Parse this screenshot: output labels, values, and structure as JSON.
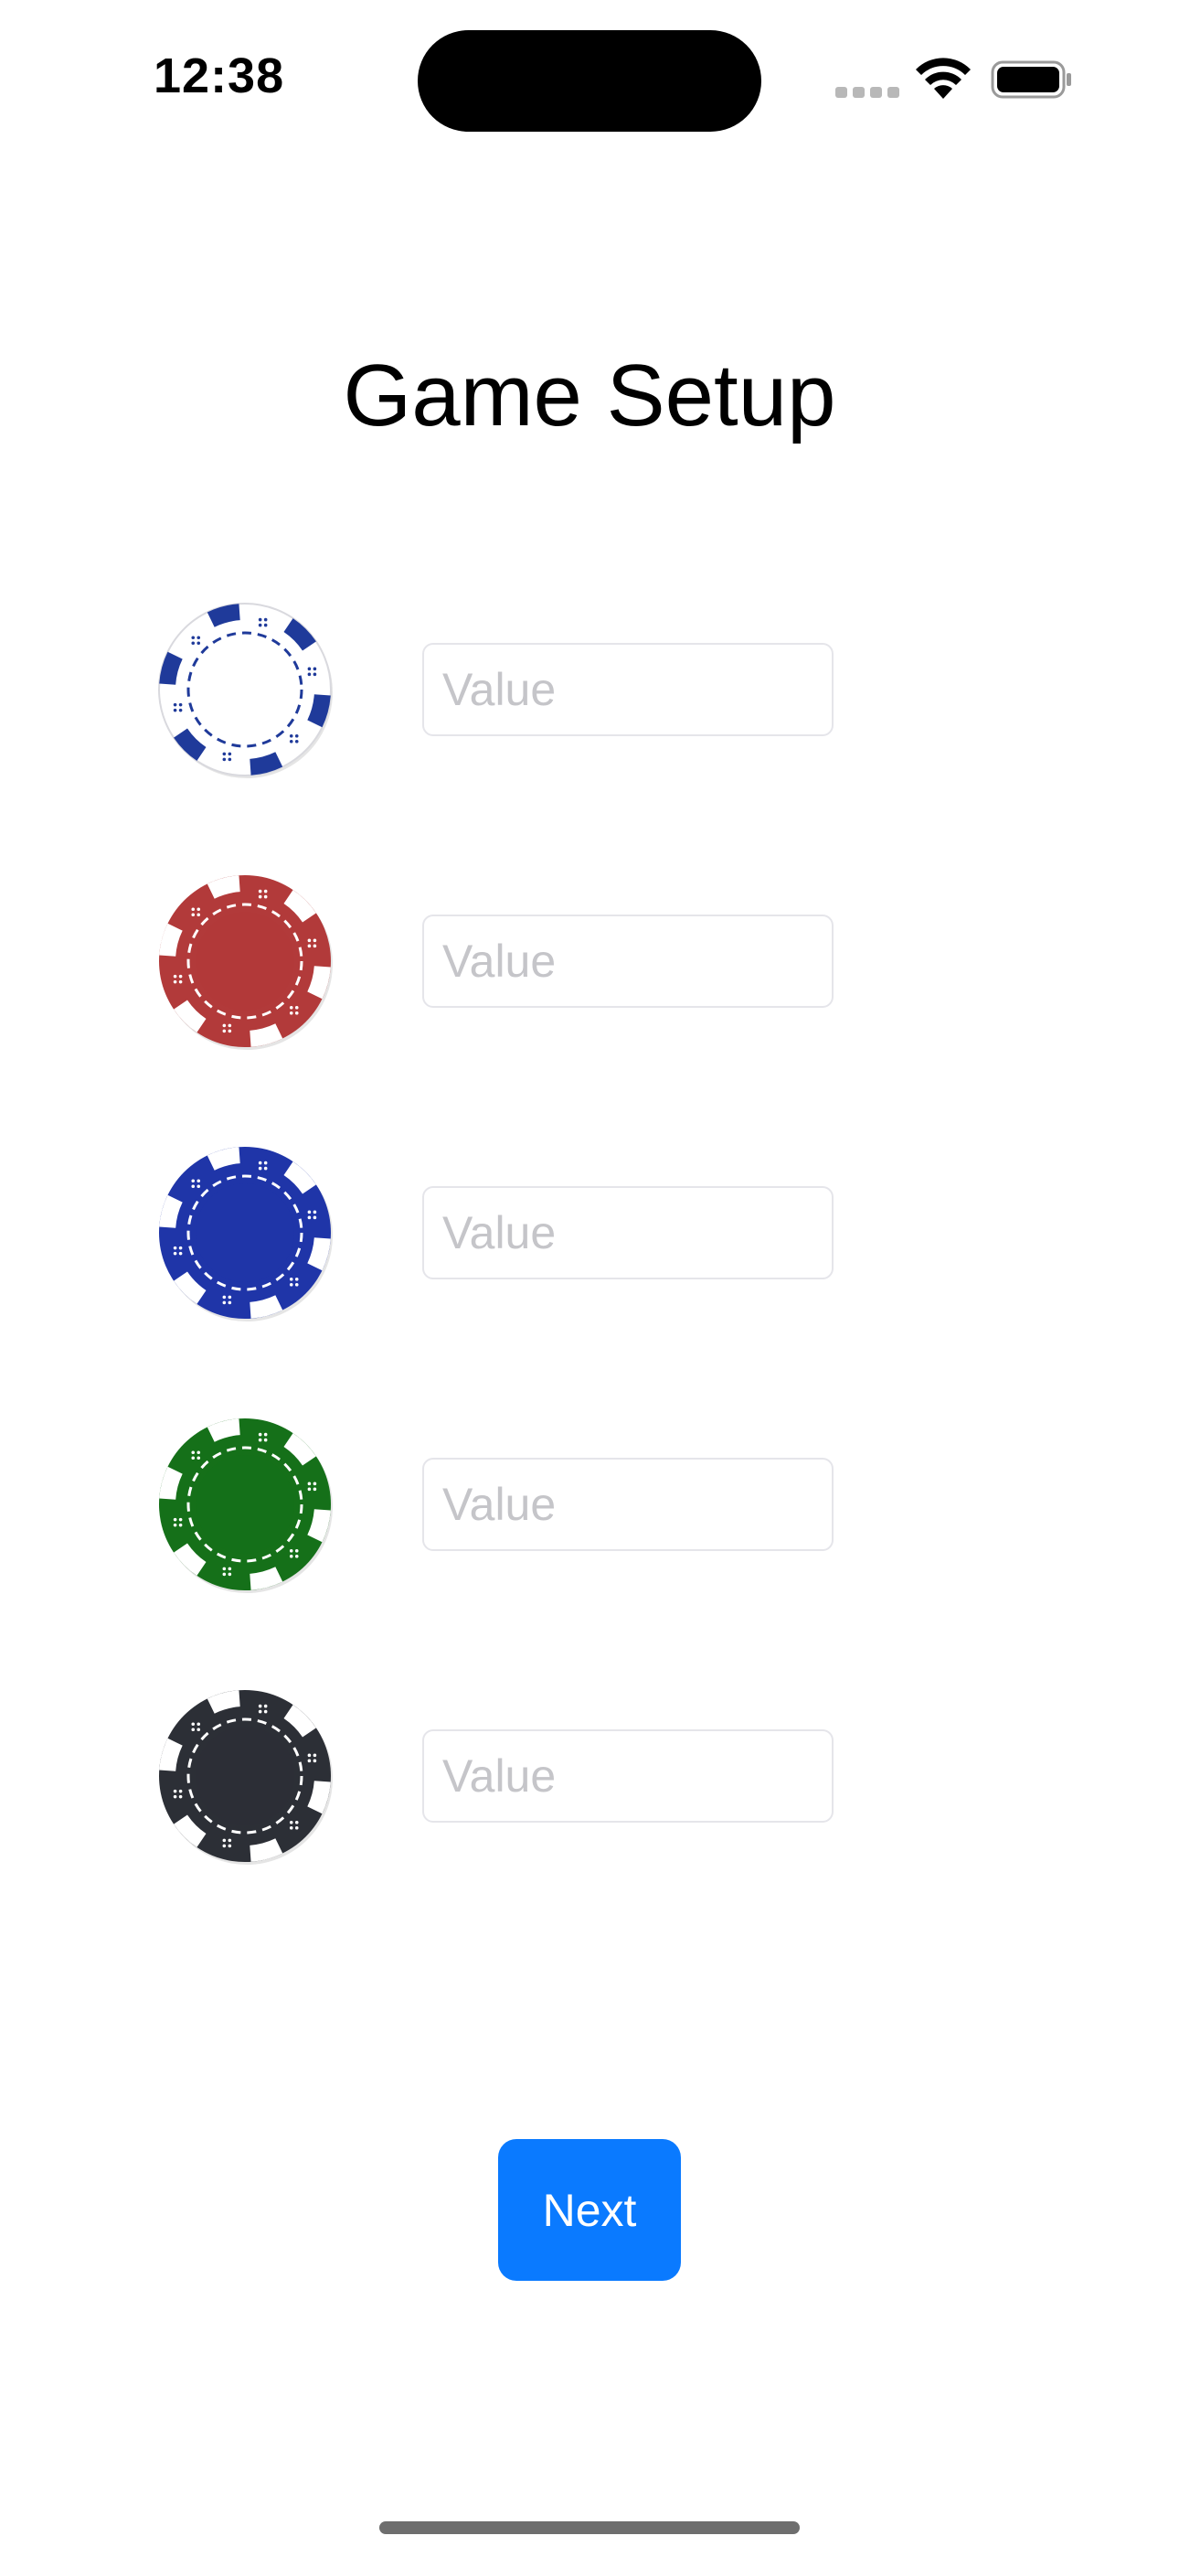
{
  "status_bar": {
    "time": "12:38",
    "signal_icon": "cellular-signal-icon",
    "wifi_icon": "wifi-icon",
    "battery_icon": "battery-icon"
  },
  "page": {
    "title": "Game Setup"
  },
  "chips": [
    {
      "color_name": "white",
      "chip_color": "#ffffff",
      "stripe_color": "#1f3a9a",
      "dot_color": "#1f3a9a",
      "placeholder": "Value",
      "value": ""
    },
    {
      "color_name": "red",
      "chip_color": "#b23a3a",
      "stripe_color": "#ffffff",
      "dot_color": "#ffffff",
      "placeholder": "Value",
      "value": ""
    },
    {
      "color_name": "blue",
      "chip_color": "#1f35a8",
      "stripe_color": "#ffffff",
      "dot_color": "#ffffff",
      "placeholder": "Value",
      "value": ""
    },
    {
      "color_name": "green",
      "chip_color": "#157019",
      "stripe_color": "#ffffff",
      "dot_color": "#ffffff",
      "placeholder": "Value",
      "value": ""
    },
    {
      "color_name": "black",
      "chip_color": "#2c2f36",
      "stripe_color": "#ffffff",
      "dot_color": "#ffffff",
      "placeholder": "Value",
      "value": ""
    }
  ],
  "actions": {
    "next_label": "Next"
  },
  "colors": {
    "accent": "#0a7aff",
    "input_border": "#e5e5ea",
    "placeholder_text": "#c5c5c9"
  }
}
